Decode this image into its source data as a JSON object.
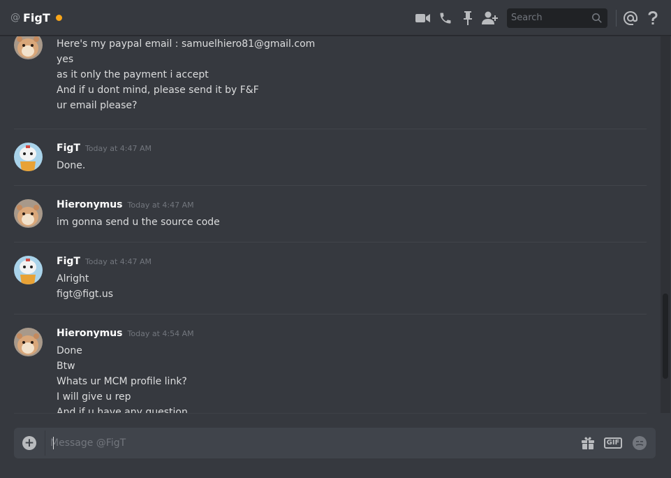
{
  "header": {
    "at_symbol": "@",
    "channel_name": "FigT",
    "status_color": "#faa61a",
    "search_placeholder": "Search",
    "icons": [
      "video-camera-icon",
      "phone-icon",
      "pin-icon",
      "add-friend-icon",
      "search-icon",
      "mentions-icon",
      "help-icon"
    ]
  },
  "messages": [
    {
      "author": "",
      "timestamp": "",
      "avatar": "hamster",
      "lines": [
        "Here's my paypal email : samuelhiero81@gmail.com",
        "yes",
        "as it only the payment i accept",
        "And if u dont mind, please send it by F&F",
        "ur email please?"
      ]
    },
    {
      "author": "FigT",
      "timestamp": "Today at 4:47 AM",
      "avatar": "robot",
      "lines": [
        "Done."
      ]
    },
    {
      "author": "Hieronymus",
      "timestamp": "Today at 4:47 AM",
      "avatar": "hamster",
      "lines": [
        "im gonna send u the source code"
      ]
    },
    {
      "author": "FigT",
      "timestamp": "Today at 4:47 AM",
      "avatar": "robot",
      "lines": [
        "Alright",
        "figt@figt.us"
      ]
    },
    {
      "author": "Hieronymus",
      "timestamp": "Today at 4:54 AM",
      "avatar": "hamster",
      "lines": [
        "Done",
        "Btw",
        "Whats ur MCM profile link?",
        "I will give u rep",
        "And if u have any question"
      ]
    }
  ],
  "composer": {
    "placeholder": "Message @FigT",
    "gif_label": "GIF",
    "icons": [
      "add-attachment-icon",
      "gift-icon",
      "gif-icon",
      "emoji-icon"
    ]
  },
  "colors": {
    "background": "#36393f",
    "accent_idle": "#faa61a",
    "text": "#dcddde",
    "muted": "#72767d"
  }
}
